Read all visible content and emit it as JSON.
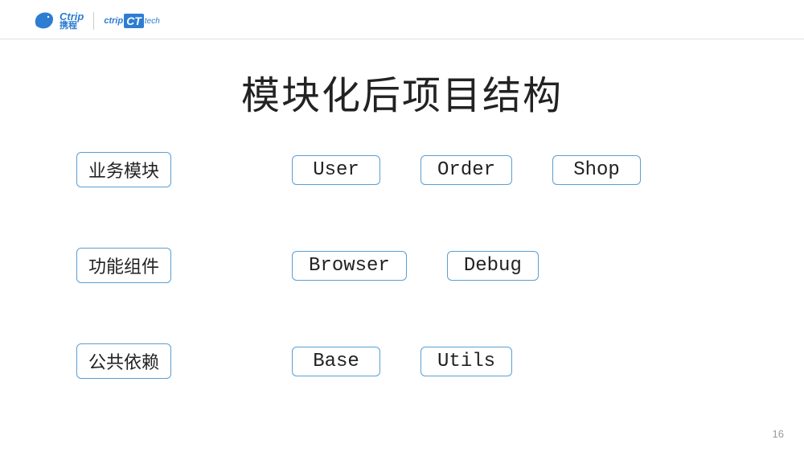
{
  "header": {
    "ctrip_en": "Ctrip",
    "ctrip_cn": "携程",
    "ct_prefix": "ctrip",
    "ct_box": "CT",
    "ct_suffix": "tech"
  },
  "title": "模块化后项目结构",
  "rows": [
    {
      "category": "业务模块",
      "modules": [
        "User",
        "Order",
        "Shop"
      ]
    },
    {
      "category": "功能组件",
      "modules": [
        "Browser",
        "Debug"
      ]
    },
    {
      "category": "公共依赖",
      "modules": [
        "Base",
        "Utils"
      ]
    }
  ],
  "page_number": "16"
}
